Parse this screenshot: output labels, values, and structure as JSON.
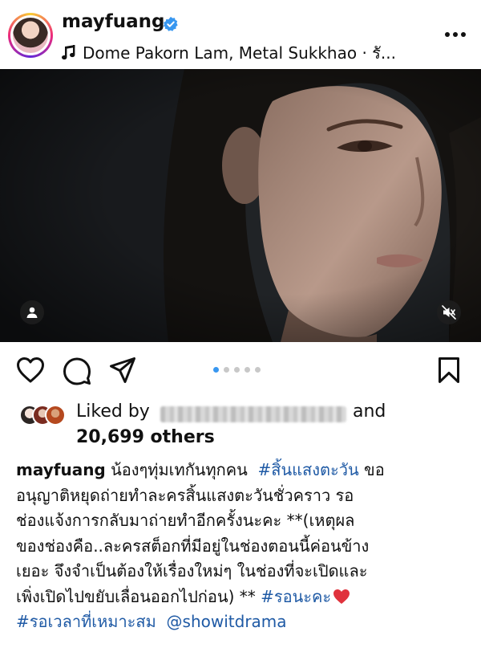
{
  "post": {
    "username": "mayfuang",
    "verified": true,
    "music": "Dome Pakorn Lam, Metal Sukkhao · รั..."
  },
  "media": {
    "carousel_count": 5,
    "carousel_active": 1
  },
  "likes": {
    "liked_by_prefix": "Liked by",
    "and_word": "and",
    "others_count": "20,699 others"
  },
  "caption": {
    "username": "mayfuang",
    "lines": [
      "น้องๆทุ่มเทกันทุกคน",
      "#สิ้นแสงตะวัน",
      "ขอ",
      "อนุญาติหยุดถ่ายทำละครสิ้นแสงตะวันชั่วคราว รอ",
      "ช่องแจ้งการกลับมาถ่ายทำอีกครั้งนะคะ **(เหตุผล",
      "ของช่องคือ..ละครสต็อกที่มีอยู่ในช่องตอนนี้ค่อนข้าง",
      "เยอะ จึงจำเป็นต้องให้เรื่องใหม่ๆ ในช่องที่จะเปิดและ",
      "เพิ่งเปิดไปขยับเลื่อนออกไปก่อน) **",
      "#รอนะคะ",
      "#รอเวลาที่เหมาะสม",
      "@showitdrama"
    ]
  },
  "colors": {
    "accent_blue": "#3897f0",
    "hashtag": "#1f5aa5",
    "heart": "#e0323c"
  },
  "icons": [
    "verified-badge-icon",
    "music-note-icon",
    "more-icon",
    "user-tag-icon",
    "muted-speaker-icon",
    "heart-icon",
    "comment-icon",
    "share-icon",
    "bookmark-icon",
    "red-heart-emoji"
  ]
}
